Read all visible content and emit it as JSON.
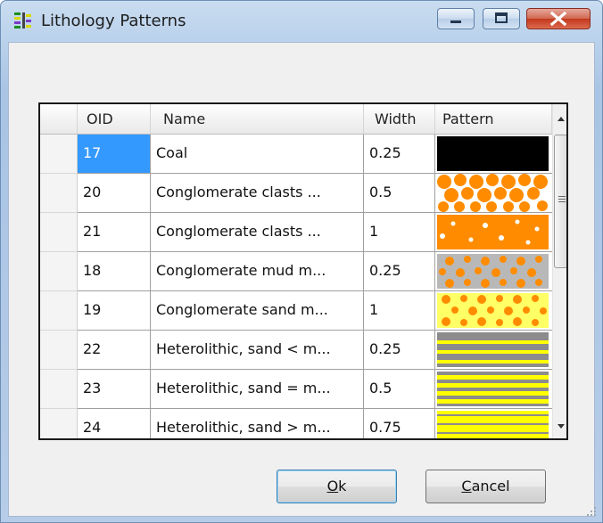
{
  "window": {
    "title": "Lithology Patterns"
  },
  "table": {
    "columns": [
      "OID",
      "Name",
      "Width",
      "Pattern"
    ],
    "rows": [
      {
        "oid": "17",
        "name": "Coal",
        "width": "0.25",
        "pattern": "solid-black"
      },
      {
        "oid": "20",
        "name": "Conglomerate clasts ...",
        "width": "0.5",
        "pattern": "orange-clasts-on-white"
      },
      {
        "oid": "21",
        "name": "Conglomerate clasts ...",
        "width": "1",
        "pattern": "orange-clasts-dense"
      },
      {
        "oid": "18",
        "name": "Conglomerate mud m...",
        "width": "0.25",
        "pattern": "orange-dots-on-grey"
      },
      {
        "oid": "19",
        "name": "Conglomerate sand m...",
        "width": "1",
        "pattern": "orange-dots-on-yellow"
      },
      {
        "oid": "22",
        "name": "Heterolithic, sand < m...",
        "width": "0.25",
        "pattern": "grey-yellow-stripes-thin"
      },
      {
        "oid": "23",
        "name": "Heterolithic, sand = m...",
        "width": "0.5",
        "pattern": "grey-yellow-stripes-even"
      },
      {
        "oid": "24",
        "name": "Heterolithic, sand > m...",
        "width": "0.75",
        "pattern": "grey-yellow-stripes-thick"
      }
    ]
  },
  "buttons": {
    "ok": {
      "mnemonic": "O",
      "rest": "k"
    },
    "cancel": {
      "mnemonic": "C",
      "rest": "ancel"
    }
  },
  "colors": {
    "selection": "#3399ff",
    "orange": "#ff8c00",
    "yellow": "#ffff00",
    "grey": "#b8b8b8",
    "black": "#000000"
  }
}
